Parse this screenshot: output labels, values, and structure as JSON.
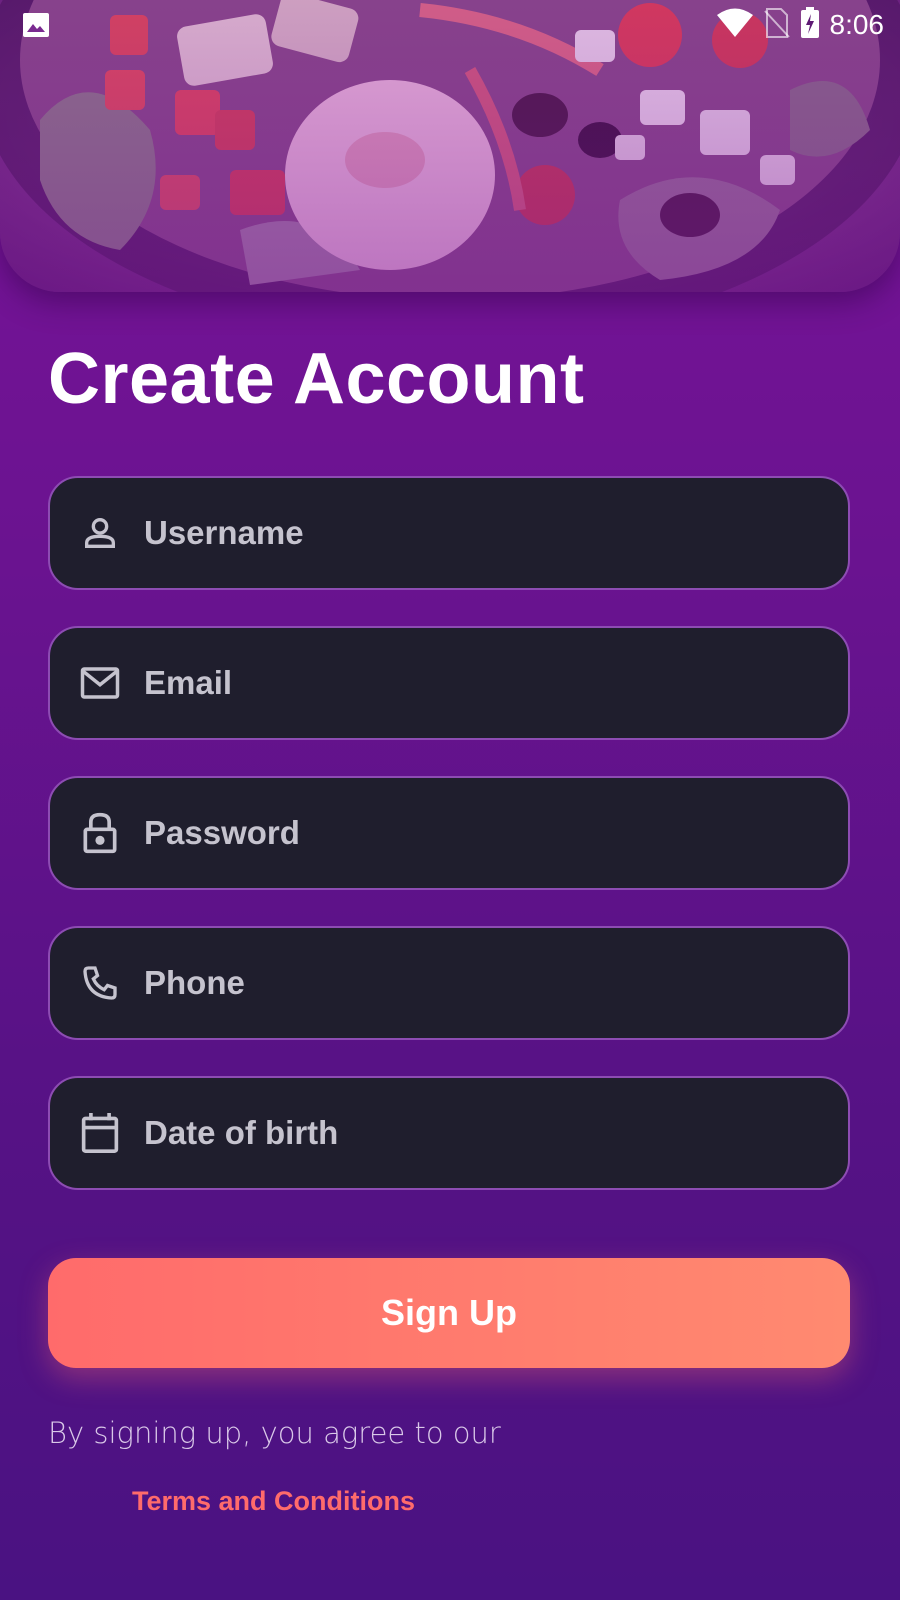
{
  "status_bar": {
    "time": "8:06",
    "icons": [
      "gallery-icon",
      "wifi-icon",
      "no-sim-icon",
      "battery-charging-icon"
    ]
  },
  "hero": {
    "image": "salad-bowl-photo"
  },
  "title": "Create Account",
  "form": {
    "fields": [
      {
        "icon": "person-icon",
        "placeholder": "Username",
        "value": ""
      },
      {
        "icon": "mail-icon",
        "placeholder": "Email",
        "value": ""
      },
      {
        "icon": "lock-icon",
        "placeholder": "Password",
        "value": ""
      },
      {
        "icon": "phone-icon",
        "placeholder": "Phone",
        "value": ""
      },
      {
        "icon": "calendar-icon",
        "placeholder": "Date of birth",
        "value": ""
      }
    ]
  },
  "signup_button": "Sign Up",
  "agreement": {
    "text": "By signing up, you agree to our",
    "link": "Terms and Conditions"
  },
  "colors": {
    "background_top": "#7a1399",
    "background_bottom": "#4a1282",
    "field_background": "#1f1e2d",
    "field_border": "#8d4cb3",
    "button_start": "#ff6b6b",
    "button_end": "#ff8a70",
    "link": "#ff6b6b"
  }
}
